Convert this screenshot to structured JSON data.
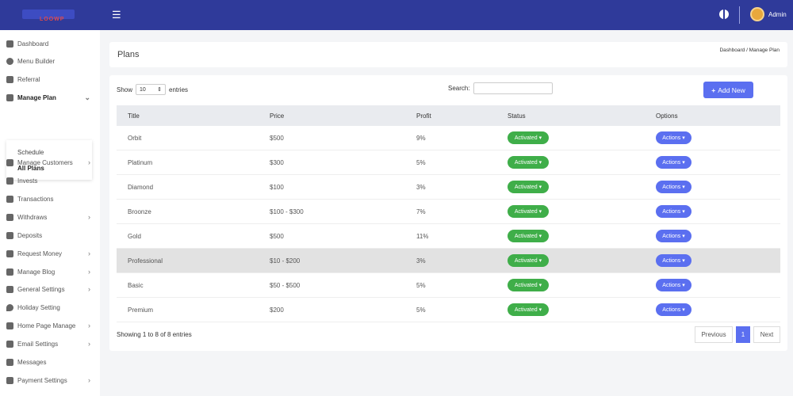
{
  "header": {
    "logo_text": "LOOWP",
    "user_name": "Admin"
  },
  "sidebar": {
    "items": [
      {
        "label": "Dashboard",
        "icon": "dashboard-icon"
      },
      {
        "label": "Menu Builder",
        "icon": "gear-icon"
      },
      {
        "label": "Referral",
        "icon": "gears-icon"
      },
      {
        "label": "Manage Plan",
        "icon": "send-icon",
        "chevron": "⌄"
      },
      {
        "label": "Manage Customers",
        "icon": "user-icon",
        "chevron": "›"
      },
      {
        "label": "Invests",
        "icon": "plant-icon"
      },
      {
        "label": "Transactions",
        "icon": "chart-icon"
      },
      {
        "label": "Withdraws",
        "icon": "monitor-icon",
        "chevron": "›"
      },
      {
        "label": "Deposits",
        "icon": "plant-icon"
      },
      {
        "label": "Request Money",
        "icon": "money-icon",
        "chevron": "›"
      },
      {
        "label": "Manage Blog",
        "icon": "blog-icon",
        "chevron": "›"
      },
      {
        "label": "General Settings",
        "icon": "gears-icon",
        "chevron": "›"
      },
      {
        "label": "Holiday Setting",
        "icon": "drop-icon"
      },
      {
        "label": "Home Page Manage",
        "icon": "home-icon",
        "chevron": "›"
      },
      {
        "label": "Email Settings",
        "icon": "email-icon",
        "chevron": "›"
      },
      {
        "label": "Messages",
        "icon": "messages-icon"
      },
      {
        "label": "Payment Settings",
        "icon": "card-icon",
        "chevron": "›"
      }
    ],
    "submenu": [
      "Schedule",
      "All Plans"
    ]
  },
  "page": {
    "title": "Plans",
    "breadcrumb": "Dashboard  /  Manage Plan"
  },
  "table_controls": {
    "show_label": "Show",
    "length_value": "10",
    "entries_label": "entries",
    "search_label": "Search:",
    "search_value": "",
    "add_new_label": "Add New"
  },
  "table": {
    "headers": [
      "Title",
      "Price",
      "Profit",
      "Status",
      "Options"
    ],
    "rows": [
      {
        "title": "Orbit",
        "price": "$500",
        "profit": "9%",
        "status": "Activated",
        "options": "Actions"
      },
      {
        "title": "Platinum",
        "price": "$300",
        "profit": "5%",
        "status": "Activated",
        "options": "Actions"
      },
      {
        "title": "Diamond",
        "price": "$100",
        "profit": "3%",
        "status": "Activated",
        "options": "Actions"
      },
      {
        "title": "Broonze",
        "price": "$100 - $300",
        "profit": "7%",
        "status": "Activated",
        "options": "Actions"
      },
      {
        "title": "Gold",
        "price": "$500",
        "profit": "11%",
        "status": "Activated",
        "options": "Actions"
      },
      {
        "title": "Professional",
        "price": "$10 - $200",
        "profit": "3%",
        "status": "Activated",
        "options": "Actions"
      },
      {
        "title": "Basic",
        "price": "$50 - $500",
        "profit": "5%",
        "status": "Activated",
        "options": "Actions"
      },
      {
        "title": "Premium",
        "price": "$200",
        "profit": "5%",
        "status": "Activated",
        "options": "Actions"
      }
    ],
    "info": "Showing 1 to 8 of 8 entries"
  },
  "pagination": {
    "previous": "Previous",
    "page": "1",
    "next": "Next"
  },
  "colors": {
    "topbar": "#2f3a9a",
    "accent": "#5b6ff0",
    "success": "#3fae49"
  }
}
